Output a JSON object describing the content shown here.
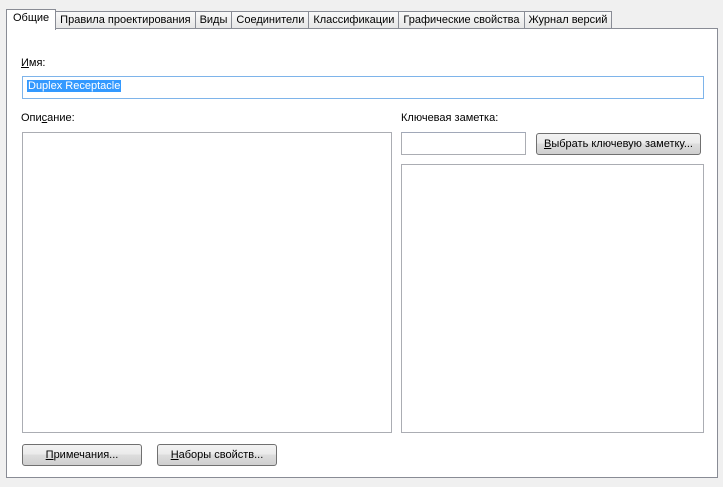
{
  "tabs": [
    {
      "label": "Общие",
      "active": true
    },
    {
      "label": "Правила проектирования"
    },
    {
      "label": "Виды"
    },
    {
      "label": "Соединители"
    },
    {
      "label": "Классификации"
    },
    {
      "label": "Графические свойства"
    },
    {
      "label": "Журнал версий"
    }
  ],
  "general": {
    "name_label_underlined": "И",
    "name_label_rest": "мя:",
    "name_value": "Duplex Receptacle",
    "description_label_start": "Опи",
    "description_label_underlined": "с",
    "description_label_end": "ание:",
    "keynote_label": "Ключевая заметка:",
    "keynote_value": "",
    "select_keynote_button_underlined": "В",
    "select_keynote_button_rest": "ыбрать ключевую заметку...",
    "notes_button_underlined": "П",
    "notes_button_rest": "римечания...",
    "property_sets_button_underlined": "Н",
    "property_sets_button_rest": "аборы свойств..."
  },
  "colors": {
    "selection": "#3399ff",
    "focus_border": "#7eb4ea"
  }
}
